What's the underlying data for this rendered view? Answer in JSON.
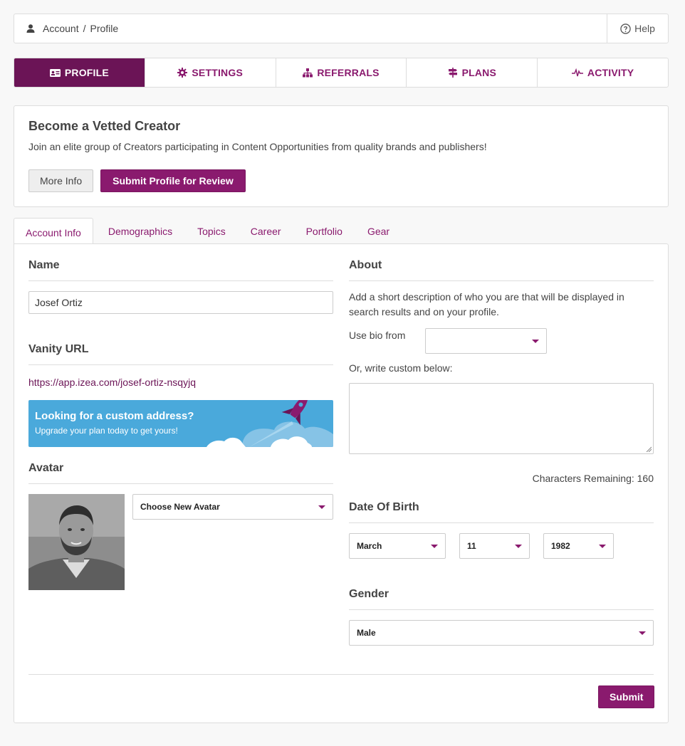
{
  "breadcrumb": {
    "icon": "user-icon",
    "items": [
      "Account",
      "Profile"
    ],
    "separator": "/"
  },
  "help": {
    "icon": "question-circle-icon",
    "label": "Help"
  },
  "main_tabs": [
    {
      "label": "PROFILE",
      "icon": "id-card-icon",
      "active": true
    },
    {
      "label": "SETTINGS",
      "icon": "gear-icon",
      "active": false
    },
    {
      "label": "REFERRALS",
      "icon": "sitemap-icon",
      "active": false
    },
    {
      "label": "PLANS",
      "icon": "signpost-icon",
      "active": false
    },
    {
      "label": "ACTIVITY",
      "icon": "pulse-icon",
      "active": false
    }
  ],
  "vetted": {
    "title": "Become a Vetted Creator",
    "text": "Join an elite group of Creators participating in Content Opportunities from quality brands and publishers!",
    "more_info": "More Info",
    "submit_review": "Submit Profile for Review"
  },
  "sub_tabs": [
    {
      "label": "Account Info",
      "active": true
    },
    {
      "label": "Demographics",
      "active": false
    },
    {
      "label": "Topics",
      "active": false
    },
    {
      "label": "Career",
      "active": false
    },
    {
      "label": "Portfolio",
      "active": false
    },
    {
      "label": "Gear",
      "active": false
    }
  ],
  "name": {
    "title": "Name",
    "value": "Josef Ortiz"
  },
  "vanity": {
    "title": "Vanity URL",
    "url": "https://app.izea.com/josef-ortiz-nsqyjq",
    "promo_title": "Looking for a custom address?",
    "promo_text": "Upgrade your plan today to get yours!"
  },
  "avatar": {
    "title": "Avatar",
    "select_label": "Choose New Avatar"
  },
  "about": {
    "title": "About",
    "description": "Add a short description of who you are that will be displayed in search results and on your profile.",
    "use_bio_label": "Use bio from",
    "use_bio_value": "",
    "custom_label": "Or, write custom below:",
    "custom_text": "",
    "chars_remaining": "Characters Remaining: 160"
  },
  "dob": {
    "title": "Date Of Birth",
    "month": "March",
    "day": "11",
    "year": "1982"
  },
  "gender": {
    "title": "Gender",
    "value": "Male"
  },
  "submit_label": "Submit",
  "colors": {
    "brand_purple": "#8a1a6e",
    "active_tab": "#6b1456",
    "promo_blue": "#4aa9db"
  }
}
